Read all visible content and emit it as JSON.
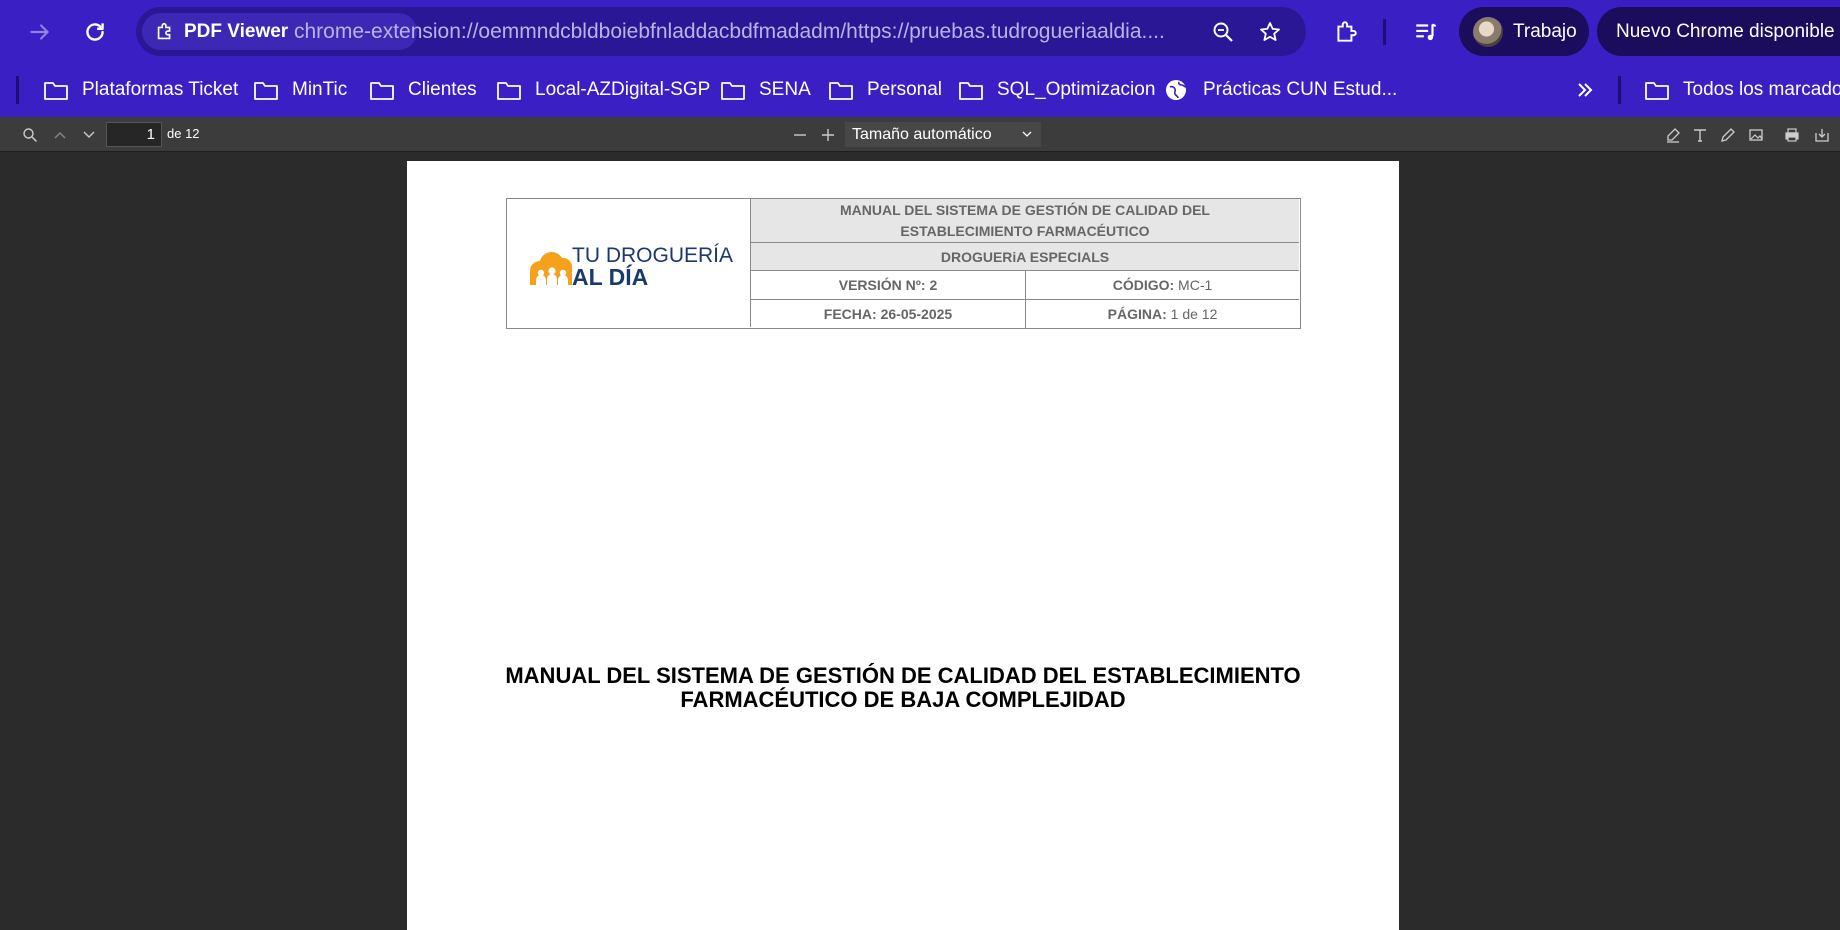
{
  "browser": {
    "url_chip_label": "PDF Viewer",
    "url": "chrome-extension://oemmndcbldboiebfnladdacbdfmadadm/https://pruebas.tudrogueriaaldia....",
    "profile_label": "Trabajo",
    "update_label": "Nuevo Chrome disponible"
  },
  "bookmarks": {
    "items": [
      {
        "label": "Plataformas Ticket",
        "icon": "folder-icon"
      },
      {
        "label": "MinTic",
        "icon": "folder-icon"
      },
      {
        "label": "Clientes",
        "icon": "folder-icon"
      },
      {
        "label": "Local-AZDigital-SGP",
        "icon": "folder-icon"
      },
      {
        "label": "SENA",
        "icon": "folder-icon"
      },
      {
        "label": "Personal",
        "icon": "folder-icon"
      },
      {
        "label": "SQL_Optimizacion",
        "icon": "folder-icon"
      },
      {
        "label": "Prácticas CUN Estud...",
        "icon": "globe-icon"
      }
    ],
    "overflow_icon": "double-chevron-icon",
    "all_bookmarks_label": "Todos los marcadores"
  },
  "pdf_toolbar": {
    "page_current": "1",
    "page_total": "de 12",
    "zoom_label": "Tamaño automático"
  },
  "document": {
    "header": {
      "logo_line1": "TU DROGUERÍA",
      "logo_line2": "AL DÍA",
      "title": "MANUAL DEL SISTEMA DE GESTIÓN DE CALIDAD DEL ESTABLECIMIENTO FARMACÉUTICO",
      "subtitle": "DROGUERiA ESPECIALS",
      "version_label": "VERSIÓN Nº:",
      "version_value": "2",
      "code_label": "CÓDIGO:",
      "code_value": "MC-1",
      "date_label": "FECHA:",
      "date_value": "26-05-2025",
      "page_label": "PÁGINA:",
      "page_value": "1 de 12"
    },
    "main_title_line1": "MANUAL DEL SISTEMA DE GESTIÓN DE CALIDAD DEL ESTABLECIMIENTO",
    "main_title_line2": "FARMACÉUTICO DE BAJA COMPLEJIDAD"
  },
  "colors": {
    "chrome_bar": "#3a1fc4",
    "omnibox": "#2a1796",
    "pdf_toolbar": "#3c3c3c",
    "viewer_bg": "#2b2b2b",
    "logo_orange": "#f5a11c",
    "logo_navy": "#1a3a6e"
  }
}
